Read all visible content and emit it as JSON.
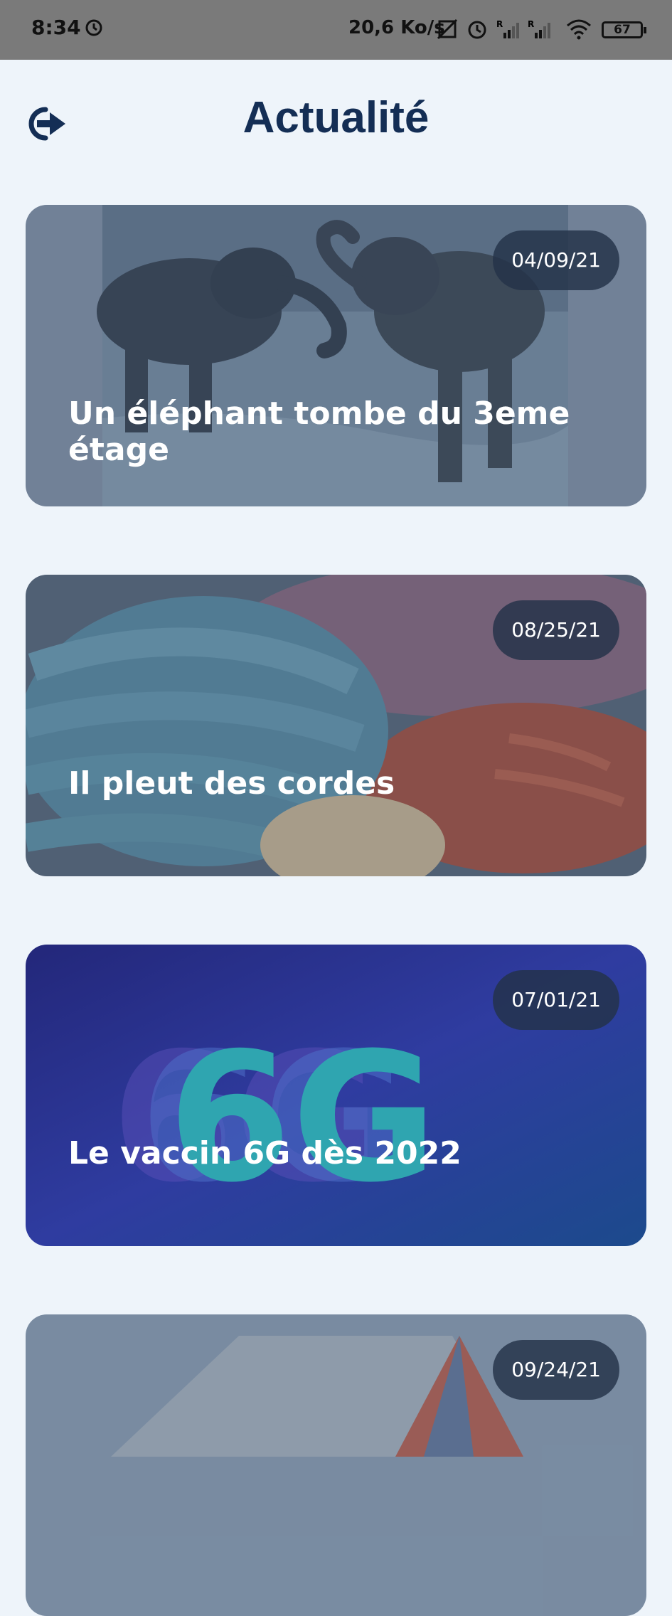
{
  "status_bar": {
    "time": "8:34",
    "speed": "20,6 Ko/s",
    "battery": "67",
    "icons": [
      "alarm-icon",
      "no-sim-icon",
      "alarm-icon",
      "signal-r-icon",
      "signal-r-icon",
      "wifi-icon",
      "battery-icon"
    ]
  },
  "header": {
    "title": "Actualité",
    "logout_icon": "logout-icon"
  },
  "articles": [
    {
      "title": "Un éléphant tombe du 3eme étage",
      "date": "04/09/21",
      "image": "elephants"
    },
    {
      "title": "Il pleut des cordes",
      "date": "08/25/21",
      "image": "ropes"
    },
    {
      "title": "Le vaccin 6G dès 2022",
      "date": "07/01/21",
      "image": "6g"
    },
    {
      "title": "",
      "date": "09/24/21",
      "image": "tent"
    }
  ],
  "colors": {
    "background": "#eef4fa",
    "title": "#142e55",
    "pill": "#233248"
  }
}
